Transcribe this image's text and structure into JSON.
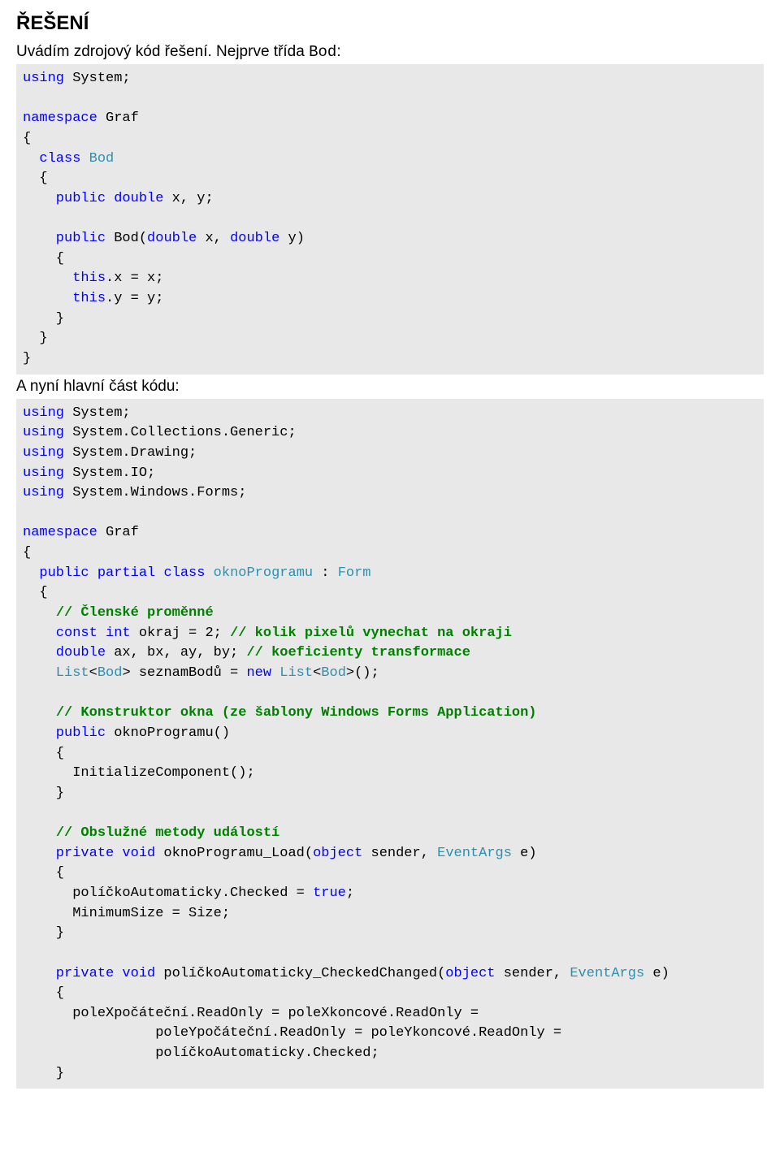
{
  "heading": "ŘEŠENÍ",
  "intro1_prefix": "Uvádím zdrojový kód řešení. Nejprve třída ",
  "intro1_code": "Bod",
  "intro1_suffix": ":",
  "section2": "A nyní hlavní část kódu:",
  "code1": {
    "l1_a": "using",
    "l1_b": " System;",
    "l2_a": "namespace",
    "l2_b": " Graf",
    "l3": "{",
    "l4_a": "  class",
    "l4_b": " ",
    "l4_c": "Bod",
    "l5": "  {",
    "l6_a": "    public",
    "l6_b": " ",
    "l6_c": "double",
    "l6_d": " x, y;",
    "l7_a": "    public",
    "l7_b": " Bod(",
    "l7_c": "double",
    "l7_d": " x, ",
    "l7_e": "double",
    "l7_f": " y)",
    "l8": "    {",
    "l9_a": "      this",
    "l9_b": ".x = x;",
    "l10_a": "      this",
    "l10_b": ".y = y;",
    "l11": "    }",
    "l12": "  }",
    "l13": "}"
  },
  "code2": {
    "l1_a": "using",
    "l1_b": " System;",
    "l2_a": "using",
    "l2_b": " System.Collections.Generic;",
    "l3_a": "using",
    "l3_b": " System.Drawing;",
    "l4_a": "using",
    "l4_b": " System.IO;",
    "l5_a": "using",
    "l5_b": " System.Windows.Forms;",
    "l6_a": "namespace",
    "l6_b": " Graf",
    "l7": "{",
    "l8_a": "  public",
    "l8_b": " ",
    "l8_c": "partial",
    "l8_d": " ",
    "l8_e": "class",
    "l8_f": " ",
    "l8_g": "oknoProgramu",
    "l8_h": " : ",
    "l8_i": "Form",
    "l9": "  {",
    "l10_a": "    ",
    "l10_b": "// Členské proměnné",
    "l11_a": "    const",
    "l11_b": " ",
    "l11_c": "int",
    "l11_d": " okraj = 2; ",
    "l11_e": "// kolik pixelů vynechat na okraji",
    "l12_a": "    double",
    "l12_b": " ax, bx, ay, by; ",
    "l12_c": "// koeficienty transformace",
    "l13_a": "    List",
    "l13_b": "<",
    "l13_c": "Bod",
    "l13_d": "> seznamBodů = ",
    "l13_e": "new",
    "l13_f": " ",
    "l13_g": "List",
    "l13_h": "<",
    "l13_i": "Bod",
    "l13_j": ">();",
    "l14_a": "    ",
    "l14_b": "// Konstruktor okna (ze šablony Windows Forms Application)",
    "l15_a": "    public",
    "l15_b": " oknoProgramu()",
    "l16": "    {",
    "l17": "      InitializeComponent();",
    "l18": "    }",
    "l19_a": "    ",
    "l19_b": "// Obslužné metody událostí",
    "l20_a": "    private",
    "l20_b": " ",
    "l20_c": "void",
    "l20_d": " oknoProgramu_Load(",
    "l20_e": "object",
    "l20_f": " sender, ",
    "l20_g": "EventArgs",
    "l20_h": " e)",
    "l21": "    {",
    "l22_a": "      políčkoAutomaticky.Checked = ",
    "l22_b": "true",
    "l22_c": ";",
    "l23": "      MinimumSize = Size;",
    "l24": "    }",
    "l25_a": "    private",
    "l25_b": " ",
    "l25_c": "void",
    "l25_d": " políčkoAutomaticky_CheckedChanged(",
    "l25_e": "object",
    "l25_f": " sender, ",
    "l25_g": "EventArgs",
    "l25_h": " e)",
    "l26": "    {",
    "l27": "      poleXpočáteční.ReadOnly = poleXkoncové.ReadOnly =",
    "l28": "                poleYpočáteční.ReadOnly = poleYkoncové.ReadOnly =",
    "l29": "                políčkoAutomaticky.Checked;",
    "l30": "    }"
  }
}
